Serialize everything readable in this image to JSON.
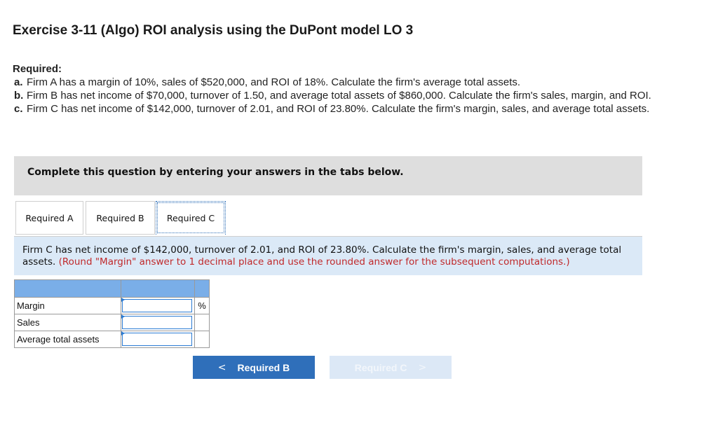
{
  "exercise": {
    "title": "Exercise 3-11 (Algo) ROI analysis using the DuPont model LO 3"
  },
  "required": {
    "heading": "Required:",
    "items": [
      {
        "label": "a.",
        "text": "Firm A has a margin of 10%, sales of $520,000, and ROI of 18%. Calculate the firm's average total assets."
      },
      {
        "label": "b.",
        "text": "Firm B has net income of $70,000, turnover of 1.50, and average total assets of $860,000. Calculate the firm's sales, margin, and ROI."
      },
      {
        "label": "c.",
        "text": "Firm C has net income of $142,000, turnover of 2.01, and ROI of 23.80%. Calculate the firm's margin, sales, and average total assets."
      }
    ]
  },
  "banner": {
    "text": "Complete this question by entering your answers in the tabs below."
  },
  "tabs": [
    {
      "label": "Required A"
    },
    {
      "label": "Required B"
    },
    {
      "label": "Required C",
      "active": true
    }
  ],
  "prompt": {
    "text": "Firm C has net income of $142,000, turnover of 2.01, and ROI of 23.80%. Calculate the firm's margin, sales, and average total assets.",
    "note": "(Round \"Margin\" answer to 1 decimal place and use the rounded answer for the subsequent computations.)"
  },
  "answer_table": {
    "rows": [
      {
        "label": "Margin",
        "value": "",
        "unit": "%"
      },
      {
        "label": "Sales",
        "value": "",
        "unit": ""
      },
      {
        "label": "Average total assets",
        "value": "",
        "unit": ""
      }
    ]
  },
  "navigation": {
    "prev_label": "Required B",
    "next_label": "Required C"
  },
  "colors": {
    "header_blue": "#7aaee8",
    "prompt_bg": "#dbe9f7",
    "note_red": "#c0292b",
    "button_blue": "#2f6fba",
    "button_disabled": "#dce8f6"
  }
}
